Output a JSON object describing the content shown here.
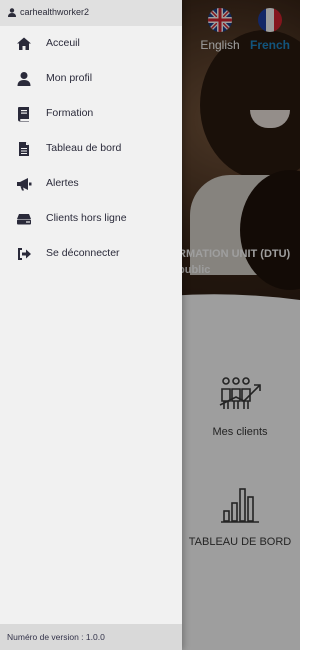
{
  "user": {
    "name": "carhealthworker2"
  },
  "menu": {
    "items": [
      {
        "label": "Acceuil",
        "icon": "home-icon"
      },
      {
        "label": "Mon profil",
        "icon": "user-icon"
      },
      {
        "label": "Formation",
        "icon": "book-icon"
      },
      {
        "label": "Tableau de bord",
        "icon": "document-icon"
      },
      {
        "label": "Alertes",
        "icon": "megaphone-icon"
      },
      {
        "label": "Clients hors ligne",
        "icon": "hard-drive-icon"
      },
      {
        "label": "Se déconnecter",
        "icon": "sign-out-icon"
      }
    ]
  },
  "footer": {
    "version": "Numéro de version : 1.0.0"
  },
  "languages": {
    "english": "English",
    "french": "French",
    "selected": "French"
  },
  "hero": {
    "title": "RMATION UNIT (DTU)",
    "subtitle": "public"
  },
  "tiles": {
    "clients": "Mes clients",
    "dashboard": "TABLEAU DE BORD"
  },
  "colors": {
    "drawer_bg": "#f1f1f1",
    "selected_language": "#1e88c8",
    "icon": "#2a2a3a"
  }
}
